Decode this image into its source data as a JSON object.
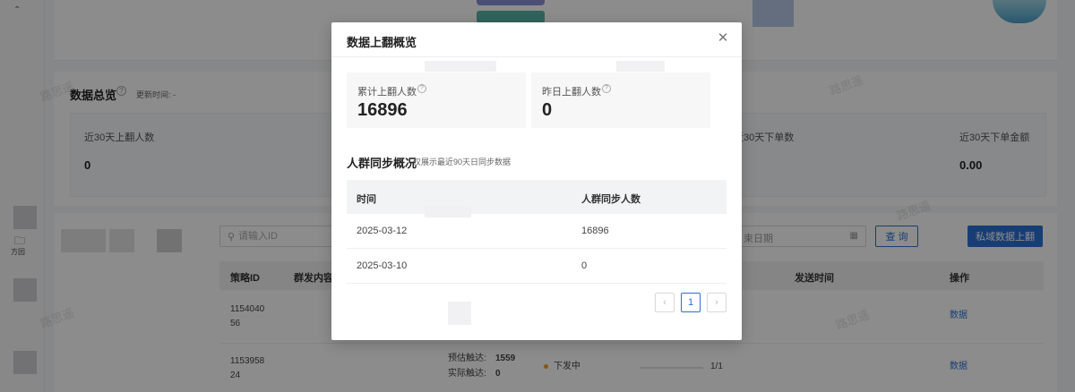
{
  "background": {
    "sidebar": {
      "folder_label": "方园"
    },
    "overview": {
      "title": "数据总览",
      "update_time": "更新时间: -",
      "metrics": [
        {
          "label": "近30天上翻人数",
          "value": "0"
        },
        {
          "label": "近30天下单数",
          "value": ""
        },
        {
          "label": "近30天下单金额",
          "value": "0.00"
        }
      ]
    },
    "filters": {
      "search_placeholder": "请输入ID",
      "date_placeholder": "束日期",
      "query_button": "查 询",
      "upload_button": "私域数据上翻"
    },
    "table": {
      "columns": [
        "策略ID",
        "群发内容",
        "发送时间",
        "操作"
      ],
      "rows": [
        {
          "id": "115404056",
          "action": "数据"
        },
        {
          "id": "115395824",
          "estimated_label": "预估触达:",
          "estimated_value": "1559",
          "actual_label": "实际触达:",
          "actual_value": "0",
          "status": "下发中",
          "progress": "1/1",
          "action": "数据"
        }
      ]
    },
    "watermark": "路思遥"
  },
  "modal": {
    "title": "数据上翻概览",
    "stats": [
      {
        "label": "累计上翻人数",
        "value": "16896"
      },
      {
        "label": "昨日上翻人数",
        "value": "0"
      }
    ],
    "section_title": "人群同步概况",
    "section_note": "仅展示最近90天日同步数据",
    "table": {
      "columns": [
        "时间",
        "人群同步人数"
      ],
      "rows": [
        {
          "date": "2025-03-12",
          "count": "16896"
        },
        {
          "date": "2025-03-10",
          "count": "0"
        }
      ]
    },
    "pagination": {
      "prev": "‹",
      "current": "1",
      "next": "›"
    }
  }
}
